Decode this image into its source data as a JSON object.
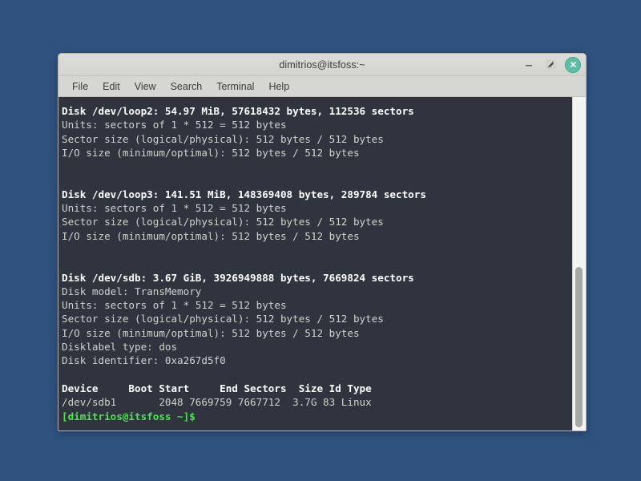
{
  "window": {
    "title": "dimitrios@itsfoss:~",
    "controls": {
      "minimize": "minimize-icon",
      "maximize": "restore-icon",
      "close": "close-icon",
      "close_glyph": "✕",
      "close_color": "#5bbfa5"
    }
  },
  "menubar": {
    "items": [
      {
        "label": "File"
      },
      {
        "label": "Edit"
      },
      {
        "label": "View"
      },
      {
        "label": "Search"
      },
      {
        "label": "Terminal"
      },
      {
        "label": "Help"
      }
    ]
  },
  "theme": {
    "desktop_bg": "#30527f",
    "titlebar_bg": "#d6d6d2",
    "terminal_bg": "#2f343f",
    "terminal_fg": "#cfd3cc",
    "terminal_bold_fg": "#ffffff",
    "prompt_fg": "#4ee44e",
    "scrollbar_track": "#f3f3f1",
    "scrollbar_thumb": "#a8a8a2"
  },
  "terminal": {
    "lines": [
      {
        "style": "bold",
        "text": "Disk /dev/loop2: 54.97 MiB, 57618432 bytes, 112536 sectors"
      },
      {
        "style": "plain",
        "text": "Units: sectors of 1 * 512 = 512 bytes"
      },
      {
        "style": "plain",
        "text": "Sector size (logical/physical): 512 bytes / 512 bytes"
      },
      {
        "style": "plain",
        "text": "I/O size (minimum/optimal): 512 bytes / 512 bytes"
      },
      {
        "style": "blank",
        "text": ""
      },
      {
        "style": "blank",
        "text": ""
      },
      {
        "style": "bold",
        "text": "Disk /dev/loop3: 141.51 MiB, 148369408 bytes, 289784 sectors"
      },
      {
        "style": "plain",
        "text": "Units: sectors of 1 * 512 = 512 bytes"
      },
      {
        "style": "plain",
        "text": "Sector size (logical/physical): 512 bytes / 512 bytes"
      },
      {
        "style": "plain",
        "text": "I/O size (minimum/optimal): 512 bytes / 512 bytes"
      },
      {
        "style": "blank",
        "text": ""
      },
      {
        "style": "blank",
        "text": ""
      },
      {
        "style": "bold",
        "text": "Disk /dev/sdb: 3.67 GiB, 3926949888 bytes, 7669824 sectors"
      },
      {
        "style": "plain",
        "text": "Disk model: TransMemory"
      },
      {
        "style": "plain",
        "text": "Units: sectors of 1 * 512 = 512 bytes"
      },
      {
        "style": "plain",
        "text": "Sector size (logical/physical): 512 bytes / 512 bytes"
      },
      {
        "style": "plain",
        "text": "I/O size (minimum/optimal): 512 bytes / 512 bytes"
      },
      {
        "style": "plain",
        "text": "Disklabel type: dos"
      },
      {
        "style": "plain",
        "text": "Disk identifier: 0xa267d5f0"
      },
      {
        "style": "blank",
        "text": ""
      },
      {
        "style": "bold",
        "text": "Device     Boot Start     End Sectors  Size Id Type"
      },
      {
        "style": "plain",
        "text": "/dev/sdb1       2048 7669759 7667712  3.7G 83 Linux"
      },
      {
        "style": "prompt",
        "text": "[dimitrios@itsfoss ~]$"
      }
    ],
    "partition_table": {
      "headers": [
        "Device",
        "Boot",
        "Start",
        "End",
        "Sectors",
        "Size",
        "Id",
        "Type"
      ],
      "rows": [
        [
          "/dev/sdb1",
          "",
          "2048",
          "7669759",
          "7667712",
          "3.7G",
          "83",
          "Linux"
        ]
      ]
    },
    "disks": [
      {
        "device": "/dev/loop2",
        "size_human": "54.97 MiB",
        "size_bytes": "57618432",
        "sectors": "112536",
        "units": "sectors of 1 * 512 = 512 bytes",
        "sector_size": "512 bytes / 512 bytes",
        "io_size": "512 bytes / 512 bytes"
      },
      {
        "device": "/dev/loop3",
        "size_human": "141.51 MiB",
        "size_bytes": "148369408",
        "sectors": "289784",
        "units": "sectors of 1 * 512 = 512 bytes",
        "sector_size": "512 bytes / 512 bytes",
        "io_size": "512 bytes / 512 bytes"
      },
      {
        "device": "/dev/sdb",
        "size_human": "3.67 GiB",
        "size_bytes": "3926949888",
        "sectors": "7669824",
        "model": "TransMemory",
        "units": "sectors of 1 * 512 = 512 bytes",
        "sector_size": "512 bytes / 512 bytes",
        "io_size": "512 bytes / 512 bytes",
        "disklabel_type": "dos",
        "disk_identifier": "0xa267d5f0"
      }
    ],
    "prompt": "[dimitrios@itsfoss ~]$"
  }
}
